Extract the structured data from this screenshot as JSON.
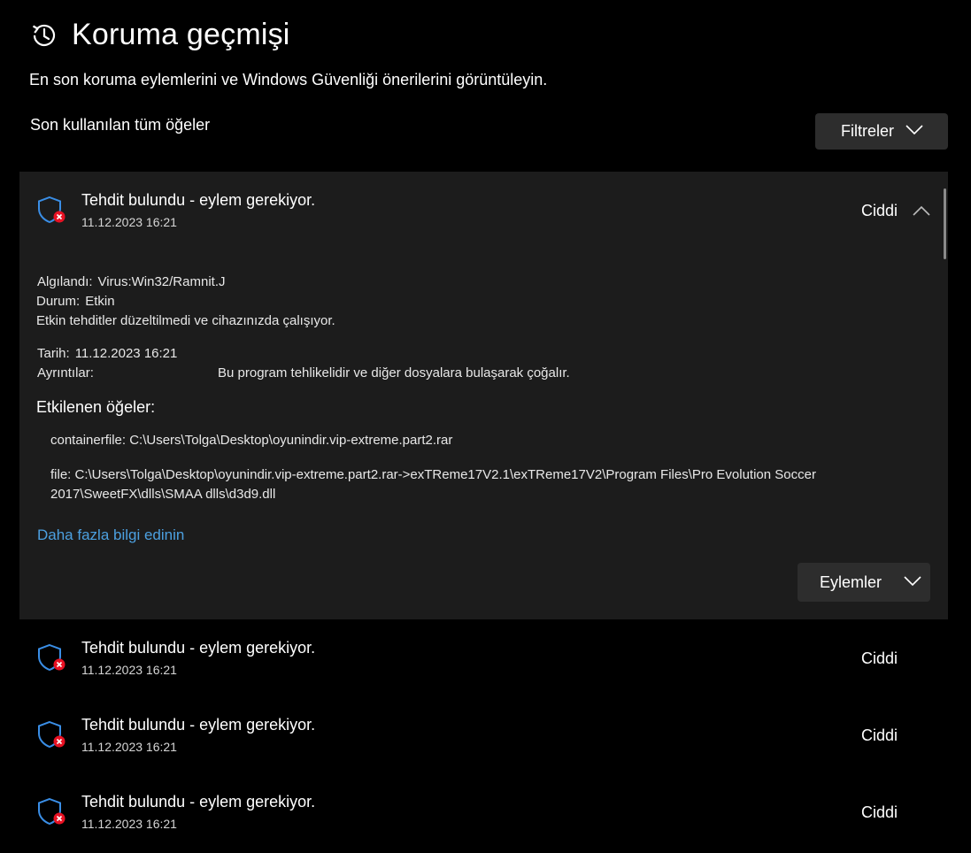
{
  "header": {
    "title": "Koruma geçmişi",
    "subtitle": "En son koruma eylemlerini ve Windows Güvenliği önerilerini görüntüleyin.",
    "icon": "history-icon"
  },
  "list": {
    "section_label": "Son kullanılan tüm öğeler",
    "filters_label": "Filtreler"
  },
  "expanded": {
    "name": "Tehdit bulundu - eylem gerekiyor.",
    "time": "11.12.2023 16:21",
    "severity": "Ciddi",
    "detected_label": "Algılandı:",
    "detected_value": "Virus:Win32/Ramnit.J",
    "status_label": "Durum:",
    "status_value": "Etkin",
    "status_note": "Etkin tehditler düzeltilmedi ve cihazınızda çalışıyor.",
    "date_label": "Tarih:",
    "date_value": "11.12.2023 16:21",
    "details_label": "Ayrıntılar:",
    "details_value": "Bu program tehlikelidir ve diğer dosyalara bulaşarak çoğalır.",
    "affected_heading": "Etkilenen öğeler:",
    "affected": [
      "containerfile: C:\\Users\\Tolga\\Desktop\\oyunindir.vip-extreme.part2.rar",
      "file: C:\\Users\\Tolga\\Desktop\\oyunindir.vip-extreme.part2.rar->exTReme17V2.1\\exTReme17V2\\Program Files\\Pro Evolution Soccer 2017\\SweetFX\\dlls\\SMAA dlls\\d3d9.dll"
    ],
    "learn_more": "Daha fazla bilgi edinin",
    "actions_label": "Eylemler"
  },
  "items": [
    {
      "name": "Tehdit bulundu - eylem gerekiyor.",
      "time": "11.12.2023 16:21",
      "severity": "Ciddi"
    },
    {
      "name": "Tehdit bulundu - eylem gerekiyor.",
      "time": "11.12.2023 16:21",
      "severity": "Ciddi"
    },
    {
      "name": "Tehdit bulundu - eylem gerekiyor.",
      "time": "11.12.2023 16:21",
      "severity": "Ciddi"
    }
  ],
  "colors": {
    "background": "#000000",
    "card": "#1c1c1c",
    "button": "#2d2d2d",
    "link": "#4ca0e0",
    "shield": "#3a8ee6",
    "alert": "#e81123"
  }
}
